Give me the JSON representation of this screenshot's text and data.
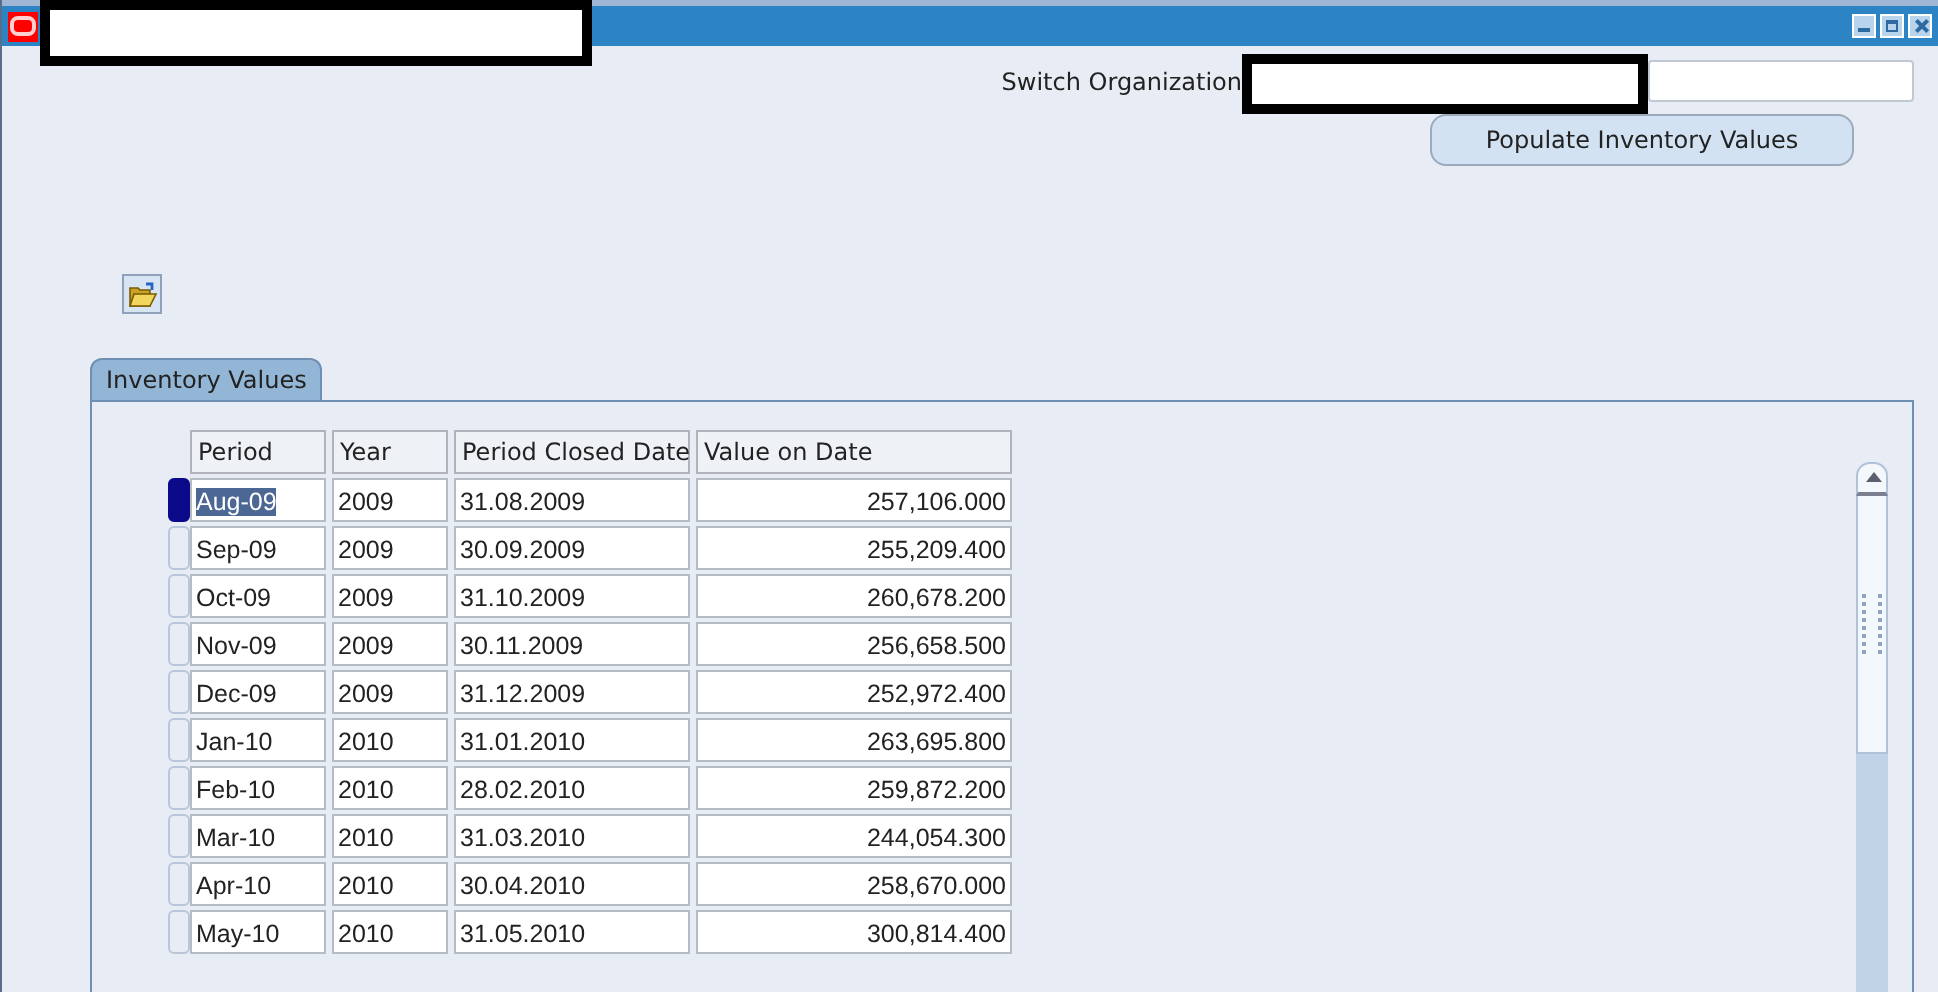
{
  "window": {
    "controls": [
      {
        "kind": "minimize"
      },
      {
        "kind": "maximize"
      },
      {
        "kind": "close"
      }
    ]
  },
  "switch_organization": {
    "label": "Switch Organization"
  },
  "populate_button": {
    "label": "Populate Inventory Values"
  },
  "tabs": [
    {
      "label": "Inventory Values",
      "selected": true
    }
  ],
  "table": {
    "columns": [
      "Period",
      "Year",
      "Period Closed Date",
      "Value on Date"
    ],
    "rows": [
      {
        "period": "Aug-09",
        "year": "2009",
        "closed": "31.08.2009",
        "value": "257,106.000",
        "selected": true
      },
      {
        "period": "Sep-09",
        "year": "2009",
        "closed": "30.09.2009",
        "value": "255,209.400",
        "selected": false
      },
      {
        "period": "Oct-09",
        "year": "2009",
        "closed": "31.10.2009",
        "value": "260,678.200",
        "selected": false
      },
      {
        "period": "Nov-09",
        "year": "2009",
        "closed": "30.11.2009",
        "value": "256,658.500",
        "selected": false
      },
      {
        "period": "Dec-09",
        "year": "2009",
        "closed": "31.12.2009",
        "value": "252,972.400",
        "selected": false
      },
      {
        "period": "Jan-10",
        "year": "2010",
        "closed": "31.01.2010",
        "value": "263,695.800",
        "selected": false
      },
      {
        "period": "Feb-10",
        "year": "2010",
        "closed": "28.02.2010",
        "value": "259,872.200",
        "selected": false
      },
      {
        "period": "Mar-10",
        "year": "2010",
        "closed": "31.03.2010",
        "value": "244,054.300",
        "selected": false
      },
      {
        "period": "Apr-10",
        "year": "2010",
        "closed": "30.04.2010",
        "value": "258,670.000",
        "selected": false
      },
      {
        "period": "May-10",
        "year": "2010",
        "closed": "31.05.2010",
        "value": "300,814.400",
        "selected": false
      }
    ]
  }
}
